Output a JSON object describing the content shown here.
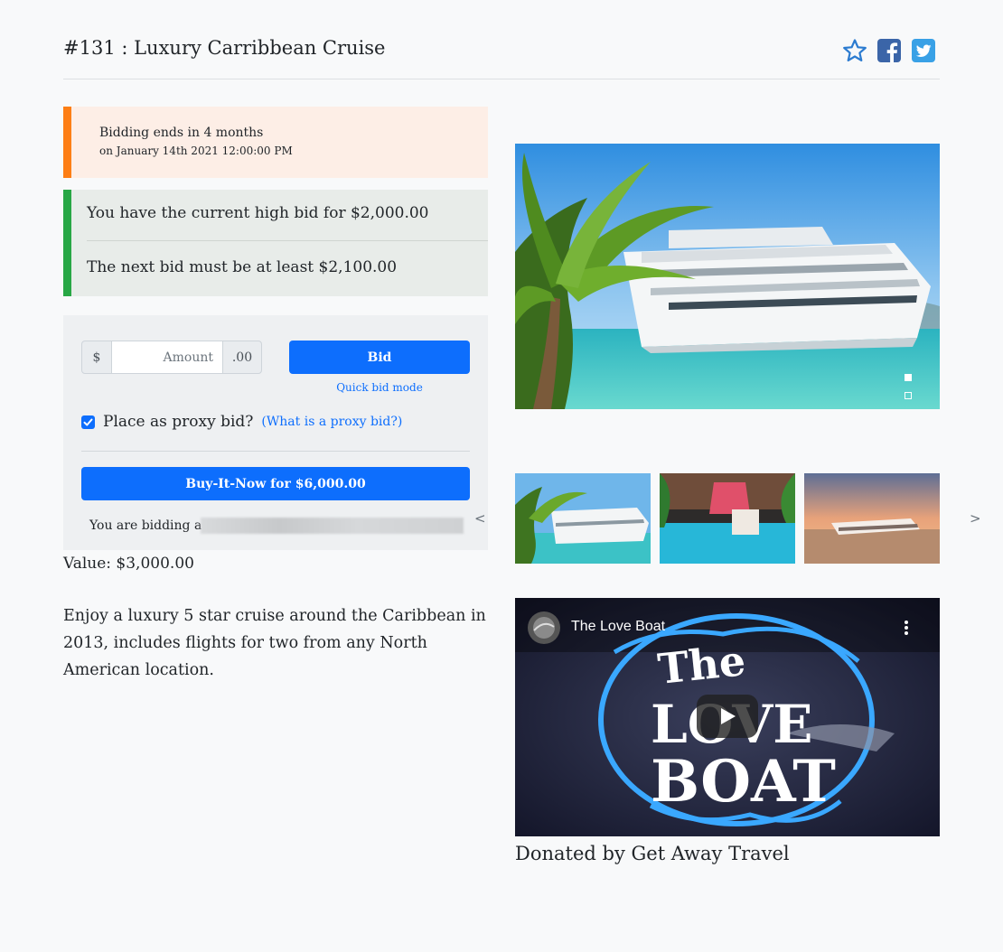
{
  "header": {
    "title": "#131 : Luxury Carribbean Cruise",
    "icons": [
      "star-outline-icon",
      "facebook-icon",
      "twitter-icon"
    ]
  },
  "bidding_end": {
    "line1": "Bidding ends in 4 months",
    "line2": "on January 14th 2021 12:00:00 PM"
  },
  "bid_status": {
    "current": "You have the current high bid for $2,000.00",
    "next": "The next bid must be at least $2,100.00"
  },
  "bid_form": {
    "currency_prefix": "$",
    "amount_placeholder": "Amount",
    "amount_value": "",
    "cents_suffix": ".00",
    "bid_label": "Bid",
    "quick_bid_label": "Quick bid mode",
    "proxy_checked": true,
    "proxy_label": "Place as proxy bid?",
    "proxy_help": "(What is a proxy bid?)",
    "buy_now_label": "Buy-It-Now for $6,000.00",
    "bidding_as_label": "You are bidding as"
  },
  "item": {
    "value": "Value: $3,000.00",
    "description": "Enjoy a luxury 5 star cruise around the Caribbean in 2013, includes flights for two from any North American location.",
    "donated_by": "Donated by Get Away Travel"
  },
  "gallery": {
    "slide_count": 2,
    "active_slide": 1,
    "prev_arrow": "<",
    "next_arrow": ">"
  },
  "video": {
    "title": "The Love Boat"
  },
  "colors": {
    "primary": "#0d6efd",
    "warning_bar": "#fd7e14",
    "success_bar": "#28a745"
  }
}
